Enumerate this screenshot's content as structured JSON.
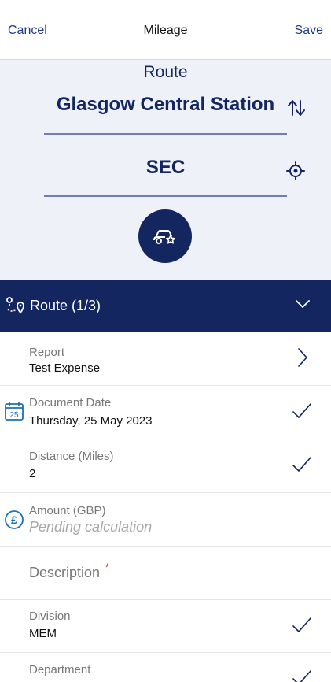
{
  "nav": {
    "cancel_label": "Cancel",
    "title": "Mileage",
    "save_label": "Save"
  },
  "route_panel": {
    "heading": "Route",
    "from": "Glasgow Central Station",
    "to": "SEC",
    "icons": [
      "swap-icon",
      "locate-icon",
      "car-star-icon"
    ]
  },
  "section": {
    "label": "Route (1/3)",
    "icons": [
      "route-pin-icon",
      "chevron-down-icon"
    ]
  },
  "fields": {
    "report": {
      "label": "Report",
      "value": "Test Expense"
    },
    "document_date": {
      "label": "Document Date",
      "value": "Thursday, 25 May 2023",
      "calendar_day": "25"
    },
    "distance": {
      "label": "Distance (Miles)",
      "value": "2"
    },
    "amount": {
      "label": "Amount (GBP)",
      "value": "Pending calculation",
      "currency_symbol": "£"
    },
    "description": {
      "label": "Description",
      "required_mark": "*"
    },
    "division": {
      "label": "Division",
      "value": "MEM"
    },
    "department": {
      "label": "Department"
    }
  },
  "colors": {
    "brand_navy": "#14265f",
    "panel_bg": "#eef1f8",
    "link_blue": "#1f3a8a",
    "required_red": "#e03a3a"
  }
}
